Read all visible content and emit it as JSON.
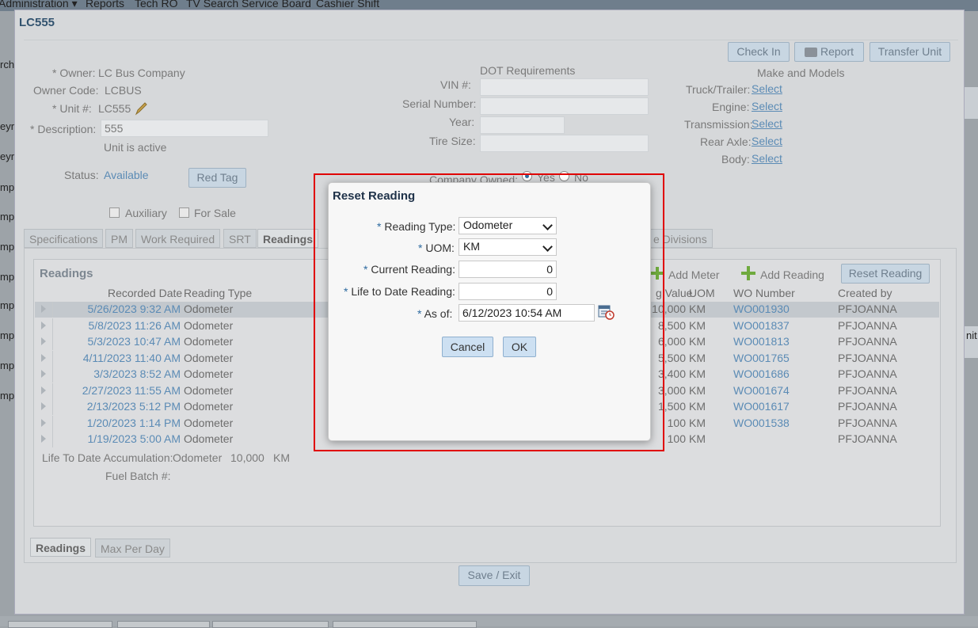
{
  "topmenu": [
    "Administration ▾",
    "Reports",
    "Tech RO",
    "TV Search Service Board",
    "Cashier Shift"
  ],
  "background_left": [
    "rch",
    "eyr",
    "eyr",
    "mp",
    "mp",
    "mp",
    "mp",
    "mp",
    "mp",
    "mp",
    "mp"
  ],
  "background_right": "nit",
  "window": {
    "title": "LC555",
    "actions": {
      "check_in": "Check In",
      "report": "Report",
      "transfer": "Transfer Unit"
    }
  },
  "unit": {
    "owner_label": "* Owner:",
    "owner": "LC Bus Company",
    "owner_code_label": "Owner Code:",
    "owner_code": "LCBUS",
    "unit_label": "* Unit #:",
    "unit": "LC555",
    "description_label": "* Description:",
    "description": "555",
    "active_text": "Unit is active",
    "status_label": "Status:",
    "status": "Available",
    "red_tag": "Red Tag",
    "auxiliary": "Auxiliary",
    "for_sale": "For Sale"
  },
  "dot": {
    "title": "DOT Requirements",
    "vin_label": "VIN #:",
    "serial_label": "Serial Number:",
    "year_label": "Year:",
    "tire_label": "Tire Size:",
    "company_owned_label": "Company Owned:",
    "yes": "Yes",
    "no": "No"
  },
  "make_models": {
    "title": "Make and Models",
    "truck": "Truck/Trailer:",
    "engine": "Engine:",
    "transmission": "Transmission:",
    "rear_axle": "Rear Axle:",
    "body": "Body:",
    "select": "Select"
  },
  "tabs": [
    "Specifications",
    "PM",
    "Work Required",
    "SRT",
    "Readings",
    "e Divisions"
  ],
  "readings": {
    "section_title": "Readings",
    "add_meter": "Add Meter",
    "add_reading": "Add Reading",
    "reset_reading": "Reset Reading",
    "columns": {
      "date": "Recorded Date",
      "type": "Reading Type",
      "value": "g Value",
      "uom": "UOM",
      "wo": "WO Number",
      "by": "Created by"
    },
    "rows": [
      {
        "date": "5/26/2023 9:32 AM",
        "type": "Odometer",
        "value": "10,000",
        "uom": "KM",
        "wo": "WO001930",
        "by": "PFJOANNA"
      },
      {
        "date": "5/8/2023 11:26 AM",
        "type": "Odometer",
        "value": "8,500",
        "uom": "KM",
        "wo": "WO001837",
        "by": "PFJOANNA"
      },
      {
        "date": "5/3/2023 10:47 AM",
        "type": "Odometer",
        "value": "6,000",
        "uom": "KM",
        "wo": "WO001813",
        "by": "PFJOANNA"
      },
      {
        "date": "4/11/2023 11:40 AM",
        "type": "Odometer",
        "value": "5,500",
        "uom": "KM",
        "wo": "WO001765",
        "by": "PFJOANNA"
      },
      {
        "date": "3/3/2023 8:52 AM",
        "type": "Odometer",
        "value": "3,400",
        "uom": "KM",
        "wo": "WO001686",
        "by": "PFJOANNA"
      },
      {
        "date": "2/27/2023 11:55 AM",
        "type": "Odometer",
        "value": "3,000",
        "uom": "KM",
        "wo": "WO001674",
        "by": "PFJOANNA"
      },
      {
        "date": "2/13/2023 5:12 PM",
        "type": "Odometer",
        "value": "1,500",
        "uom": "KM",
        "wo": "WO001617",
        "by": "PFJOANNA"
      },
      {
        "date": "1/20/2023 1:14 PM",
        "type": "Odometer",
        "value": "100",
        "uom": "KM",
        "wo": "WO001538",
        "by": "PFJOANNA"
      },
      {
        "date": "1/19/2023 5:00 AM",
        "type": "Odometer",
        "value": "100",
        "uom": "KM",
        "wo": "",
        "by": "PFJOANNA"
      }
    ],
    "ltd_label": "Life To Date Accumulation:",
    "ltd_type": "Odometer",
    "ltd_value": "10,000",
    "ltd_uom": "KM",
    "fuel_batch_label": "Fuel Batch #:"
  },
  "bottom_tabs": [
    "Readings",
    "Max Per Day"
  ],
  "save_exit": "Save / Exit",
  "dialog": {
    "title": "Reset Reading",
    "reading_type_label": "Reading Type:",
    "reading_type": "Odometer",
    "uom_label": "UOM:",
    "uom": "KM",
    "current_label": "Current Reading:",
    "current": "0",
    "ltd_label": "Life to Date Reading:",
    "ltd": "0",
    "asof_label": "As of:",
    "asof": "6/12/2023 10:54 AM",
    "cancel": "Cancel",
    "ok": "OK"
  },
  "colors": {
    "highlight": "#e00000",
    "link": "#5b8bb5",
    "title": "#20334a"
  }
}
